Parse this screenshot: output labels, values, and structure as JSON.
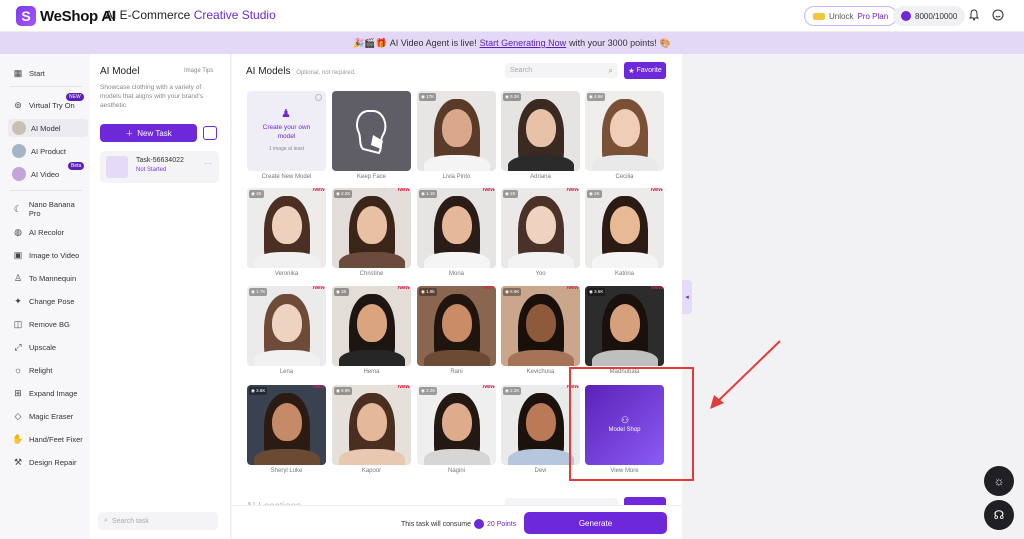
{
  "header": {
    "logo_mark": "S",
    "logo_text": "WeShop AI",
    "title_main": "AI E-Commerce",
    "title_accent": "Creative Studio",
    "unlock_prefix": "Unlock",
    "unlock_accent": "Pro Plan",
    "points": "8000/10000"
  },
  "banner": {
    "emoji_prefix": "🎉🎬🎁",
    "text_before": "AI Video Agent is live!",
    "link": "Start Generating Now",
    "text_after": "with your 3000 points!",
    "emoji_suffix": "🎨"
  },
  "leftnav": {
    "start": "Start",
    "virtual_try_on": "Virtual Try On",
    "badge_new": "NEW",
    "ai_model": "AI Model",
    "ai_product": "AI Product",
    "ai_video": "AI Video",
    "badge_beta": "Beta",
    "nano_banana": "Nano Banana Pro",
    "ai_recolor": "AI Recolor",
    "image_to_video": "Image to Video",
    "to_mannequin": "To Mannequin",
    "change_pose": "Change Pose",
    "remove_bg": "Remove BG",
    "upscale": "Upscale",
    "relight": "Relight",
    "expand_image": "Expand Image",
    "magic_eraser": "Magic Eraser",
    "hand_feet_fixer": "Hand/Feet Fixer",
    "design_repair": "Design Repair"
  },
  "taskpanel": {
    "title": "AI Model",
    "image_tips": "Image Tips",
    "description": "Showcase clothing with a variety of models that aligns with your brand's aesthetic",
    "new_task": "New Task",
    "task_name": "Task-56634022",
    "task_status": "Not Started",
    "task_more": "···",
    "search_placeholder": "Search task"
  },
  "main": {
    "title": "AI Models",
    "optional": "Optional, not required.",
    "search_placeholder": "Search",
    "favorite": "Favorite",
    "create_text": "Create your own model",
    "create_sub": "1 image at least",
    "model_shop": "Model Shop",
    "ai_locations": "AI Locations",
    "new_tag": "New"
  },
  "models": [
    {
      "name": "Create New Model",
      "type": "create"
    },
    {
      "name": "Keep Face",
      "type": "keepface"
    },
    {
      "name": "Livia Pinto",
      "count": "17K",
      "skin": "#d9a88a",
      "hair": "#5a3a28",
      "top": "#f4f4f4",
      "bg": "#e8e6e4",
      "new": false
    },
    {
      "name": "Adriana",
      "count": "5.3K",
      "skin": "#e8c2a8",
      "hair": "#3a2a22",
      "top": "#2b2b2b",
      "bg": "#e5e4e2",
      "new": false
    },
    {
      "name": "Cecilia",
      "count": "4.6K",
      "skin": "#efcdb6",
      "hair": "#7a5037",
      "top": "#e9e9e9",
      "bg": "#f0eeec",
      "new": false
    },
    {
      "name": "Veronika",
      "count": "3K",
      "skin": "#efd0bd",
      "hair": "#4a2f22",
      "top": "#f1f1f1",
      "bg": "#eeeceb",
      "new": true
    },
    {
      "name": "Christine",
      "count": "2.2K",
      "skin": "#e8c0a4",
      "hair": "#3b2418",
      "top": "#6b4b3b",
      "bg": "#e2ddd8",
      "new": true
    },
    {
      "name": "Mona",
      "count": "1.1K",
      "skin": "#e4b899",
      "hair": "#2a1c16",
      "top": "#f5f5f5",
      "bg": "#e7e5e3",
      "new": true
    },
    {
      "name": "Yoo",
      "count": "2K",
      "skin": "#efd2c0",
      "hair": "#4a3228",
      "top": "#f3f3f3",
      "bg": "#ebe9e8",
      "new": true
    },
    {
      "name": "Katrina",
      "count": "2K",
      "skin": "#e7b995",
      "hair": "#2b1b14",
      "top": "#f5f5f5",
      "bg": "#ecebe9",
      "new": true
    },
    {
      "name": "Lena",
      "count": "1.7K",
      "skin": "#efd3c2",
      "hair": "#6e4b38",
      "top": "#f1f1f1",
      "bg": "#ebebeb",
      "new": true
    },
    {
      "name": "Hema",
      "count": "3K",
      "skin": "#d9a47e",
      "hair": "#1d1512",
      "top": "#262626",
      "bg": "#e2ddd6",
      "new": true
    },
    {
      "name": "Rani",
      "count": "1.9k",
      "skin": "#c98c66",
      "hair": "#1f140e",
      "top": "#6c4a33",
      "bg": "#8a6650",
      "new": true
    },
    {
      "name": "Kevichusa",
      "count": "6.9K",
      "skin": "#8e5a3c",
      "hair": "#1a100b",
      "top": "#a57355",
      "bg": "#caa68c",
      "new": true
    },
    {
      "name": "Madhubala",
      "count": "3.6K",
      "skin": "#d7a07c",
      "hair": "#1a110c",
      "top": "#bfbfbf",
      "bg": "#2c2c2c",
      "new": true
    },
    {
      "name": "Sheryl Luke",
      "count": "3.6K",
      "skin": "#c58b66",
      "hair": "#2b1b13",
      "top": "#6b4a34",
      "bg": "#3a4252",
      "new": true
    },
    {
      "name": "Kapoor",
      "count": "6.9K",
      "skin": "#e4b999",
      "hair": "#4a2e1f",
      "top": "#e8c8b0",
      "bg": "#e6e0da",
      "new": true
    },
    {
      "name": "Nagini",
      "count": "2.2K",
      "skin": "#dcac8c",
      "hair": "#241812",
      "top": "#d6d6d6",
      "bg": "#efefef",
      "new": true
    },
    {
      "name": "Devi",
      "count": "2.2K",
      "skin": "#b97a55",
      "hair": "#1c120d",
      "top": "#b6c6dc",
      "bg": "#eaeaea",
      "new": true
    },
    {
      "name": "View More",
      "type": "shop"
    }
  ],
  "bottom": {
    "consume_text": "This task will consume",
    "points": "20 Points",
    "generate": "Generate"
  },
  "colors": {
    "accent": "#6d28d9",
    "highlight": "#e33b3b"
  }
}
